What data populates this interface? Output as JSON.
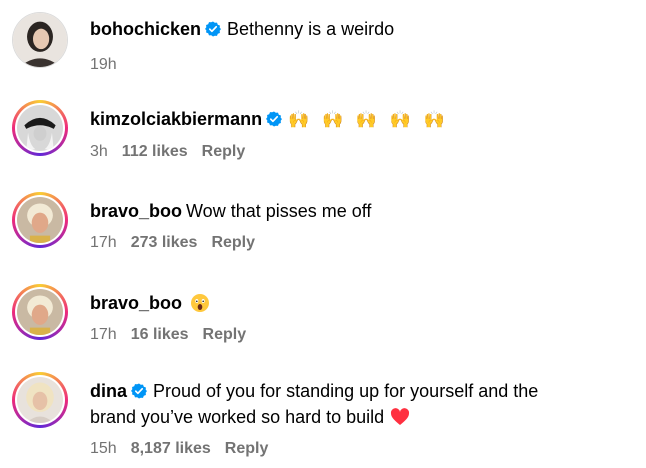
{
  "comments": [
    {
      "username": "bohochicken",
      "verified": true,
      "text": "Bethenny is a weirdo",
      "time": "19h",
      "likes": "",
      "reply": ""
    },
    {
      "username": "kimzolciakbiermann",
      "verified": true,
      "text": "🙌 🙌 🙌 🙌 🙌",
      "time": "3h",
      "likes": "112 likes",
      "reply": "Reply"
    },
    {
      "username": "bravo_boo",
      "verified": false,
      "text": "Wow that pisses me off",
      "time": "17h",
      "likes": "273 likes",
      "reply": "Reply"
    },
    {
      "username": "bravo_boo",
      "verified": false,
      "text": "",
      "emoji": "shocked-face",
      "time": "17h",
      "likes": "16 likes",
      "reply": "Reply"
    },
    {
      "username": "dina",
      "verified": true,
      "text": "Proud of you for standing up for yourself and the",
      "text_line2": "brand you’ve worked so hard to build",
      "emoji_end": "heart",
      "time": "15h",
      "likes": "8,187 likes",
      "reply": "Reply"
    }
  ],
  "colors": {
    "verified": "#0095f6",
    "meta": "#737373",
    "heart": "#ff3040"
  }
}
